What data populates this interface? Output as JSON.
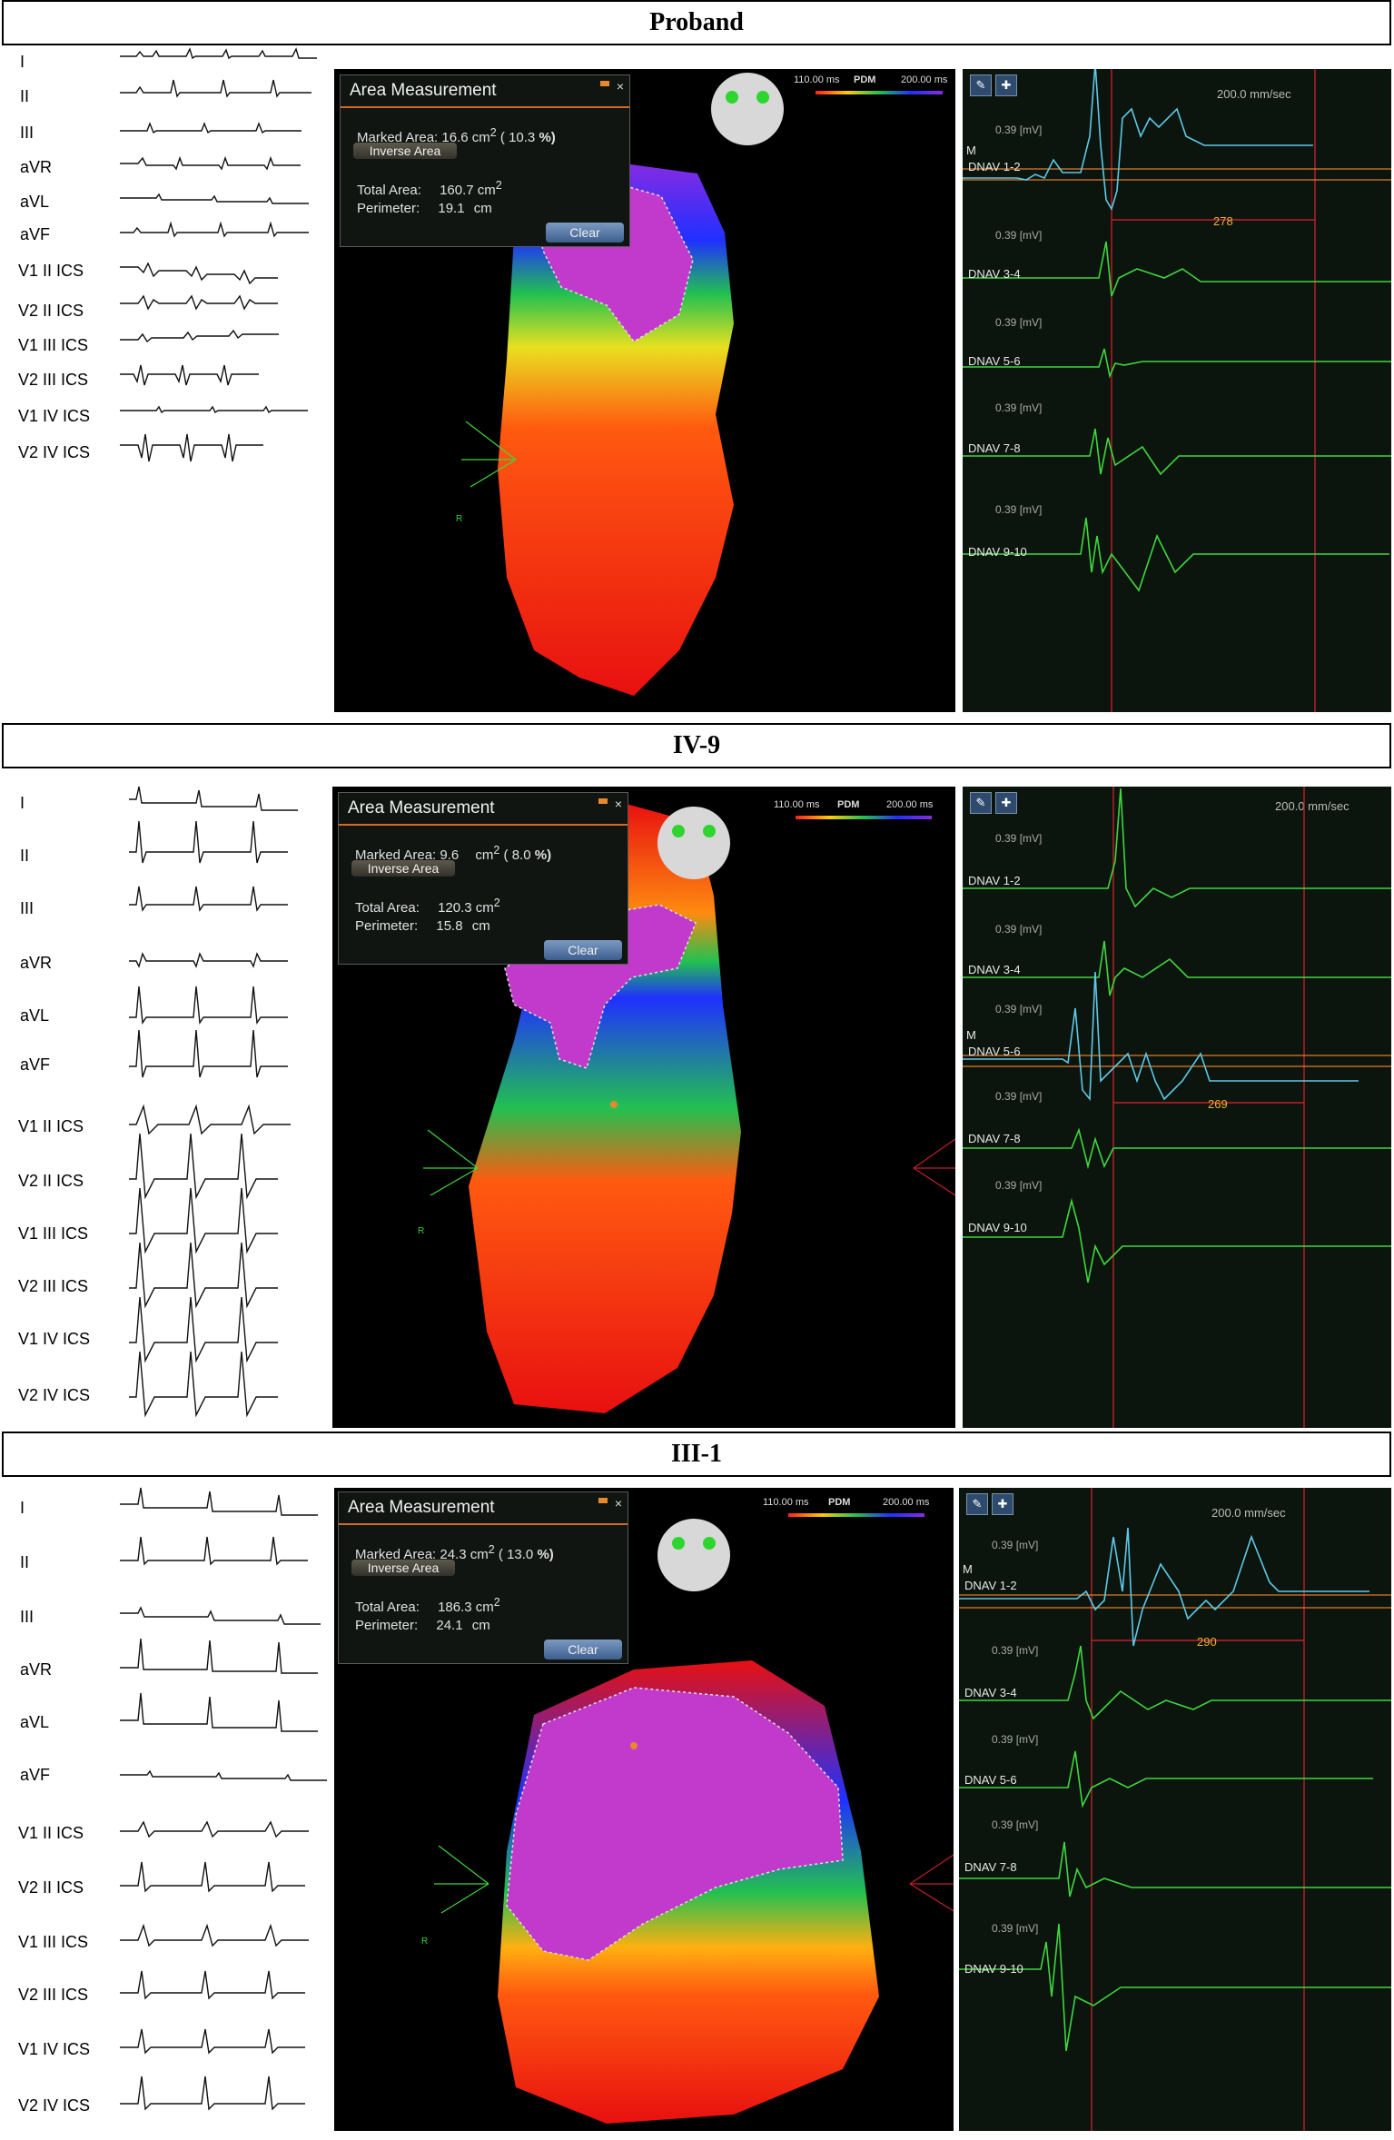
{
  "sections": [
    {
      "title": "Proband",
      "leads": [
        "I",
        "II",
        "III",
        "aVR",
        "aVL",
        "aVF",
        "V1 II ICS",
        "V2 II ICS",
        "V1 III ICS",
        "V2 III ICS",
        "V1 IV ICS",
        "V2 IV ICS"
      ],
      "area": {
        "title": "Area Measurement",
        "marked_label": "Marked Area:",
        "marked_value": "16.6",
        "unit": "cm",
        "exp": "2",
        "pct_open": "(",
        "pct_value": "10.3",
        "pct_unit": "%)",
        "inverse": "Inverse Area",
        "total_label": "Total Area:",
        "total_value": "160.7",
        "perimeter_label": "Perimeter:",
        "perimeter_value": "19.1",
        "perimeter_unit": "cm",
        "clear": "Clear",
        "close": "×"
      },
      "legend": {
        "min": "110.00 ms",
        "label": "PDM",
        "max": "200.00 ms"
      },
      "egm": {
        "speed": "200.0 mm/sec",
        "mv": "0.39  [mV]",
        "channels": [
          "DNAV 1-2",
          "DNAV 3-4",
          "DNAV 5-6",
          "DNAV 7-8",
          "DNAV 9-10"
        ],
        "marker": "M",
        "interval": "278",
        "active_channel": 0
      }
    },
    {
      "title": "IV-9",
      "leads": [
        "I",
        "II",
        "III",
        "aVR",
        "aVL",
        "aVF",
        "V1 II ICS",
        "V2 II ICS",
        "V1 III ICS",
        "V2 III ICS",
        "V1 IV ICS",
        "V2 IV ICS"
      ],
      "area": {
        "title": "Area Measurement",
        "marked_label": "Marked Area:",
        "marked_value": "9.6",
        "unit": "cm",
        "exp": "2",
        "pct_open": "(",
        "pct_value": "8.0",
        "pct_unit": "%)",
        "inverse": "Inverse Area",
        "total_label": "Total Area:",
        "total_value": "120.3",
        "perimeter_label": "Perimeter:",
        "perimeter_value": "15.8",
        "perimeter_unit": "cm",
        "clear": "Clear",
        "close": "×"
      },
      "legend": {
        "min": "110.00 ms",
        "label": "PDM",
        "max": "200.00 ms"
      },
      "egm": {
        "speed": "200.0 mm/sec",
        "mv": "0.39  [mV]",
        "channels": [
          "DNAV 1-2",
          "DNAV 3-4",
          "DNAV 5-6",
          "DNAV 7-8",
          "DNAV 9-10"
        ],
        "marker": "M",
        "interval": "269",
        "active_channel": 2
      }
    },
    {
      "title": "III-1",
      "leads": [
        "I",
        "II",
        "III",
        "aVR",
        "aVL",
        "aVF",
        "V1 II ICS",
        "V2 II ICS",
        "V1 III ICS",
        "V2 III ICS",
        "V1 IV ICS",
        "V2 IV ICS"
      ],
      "area": {
        "title": "Area Measurement",
        "marked_label": "Marked Area:",
        "marked_value": "24.3",
        "unit": "cm",
        "exp": "2",
        "pct_open": "(",
        "pct_value": "13.0",
        "pct_unit": "%)",
        "inverse": "Inverse Area",
        "total_label": "Total Area:",
        "total_value": "186.3",
        "perimeter_label": "Perimeter:",
        "perimeter_value": "24.1",
        "perimeter_unit": "cm",
        "clear": "Clear",
        "close": "×"
      },
      "legend": {
        "min": "110.00 ms",
        "label": "PDM",
        "max": "200.00 ms"
      },
      "egm": {
        "speed": "200.0 mm/sec",
        "mv": "0.39  [mV]",
        "channels": [
          "DNAV 1-2",
          "DNAV 3-4",
          "DNAV 5-6",
          "DNAV 7-8",
          "DNAV 9-10"
        ],
        "marker": "M",
        "interval": "290",
        "active_channel": 0
      }
    }
  ],
  "orientation_label": "R",
  "colors": {
    "green_trace": "#3fd63f",
    "blue_trace": "#5ec8e8",
    "orange_line": "#e07a2a",
    "red_line": "#c0202a",
    "panel_accent": "#d36a1e"
  }
}
